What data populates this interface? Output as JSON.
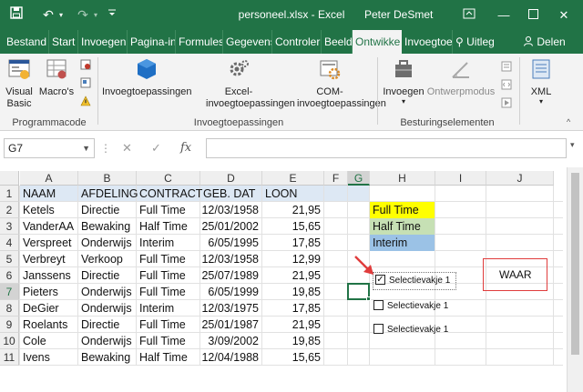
{
  "titlebar": {
    "save_icon": "save-icon",
    "undo_icon": "undo-icon",
    "redo_icon": "redo-icon",
    "title": "personeel.xlsx - Excel",
    "user": "Peter DeSmet",
    "accent": "#217346"
  },
  "tabs": [
    {
      "label": "Bestand"
    },
    {
      "label": "Start"
    },
    {
      "label": "Invoegen"
    },
    {
      "label": "Pagina-in"
    },
    {
      "label": "Formules"
    },
    {
      "label": "Gegevens"
    },
    {
      "label": "Controler"
    },
    {
      "label": "Beeld"
    },
    {
      "label": "Ontwikke"
    },
    {
      "label": "Invoegtoe"
    },
    {
      "label": "Uitleg"
    }
  ],
  "share_label": "Delen",
  "ribbon": {
    "vb_label": "Visual Basic",
    "macros_label": "Macro's",
    "group1": "Programmacode",
    "invoeg_label": "Invoegtoepassingen",
    "excel_invoeg_label": "Excel-invoegtoepassingen",
    "com_invoeg_label": "COM-invoegtoepassingen",
    "group2": "Invoegtoepassingen",
    "invoegen_label": "Invoegen",
    "ontwerpmodus_label": "Ontwerpmodus",
    "group3": "Besturingselementen",
    "xml_label": "XML"
  },
  "formula_bar": {
    "namebox": "G7",
    "fx": "fx",
    "content": ""
  },
  "grid": {
    "columns": [
      "A",
      "B",
      "C",
      "D",
      "E",
      "F",
      "G",
      "H",
      "I",
      "J"
    ],
    "rows": [
      "1",
      "2",
      "3",
      "4",
      "5",
      "6",
      "7",
      "8",
      "9",
      "10",
      "11"
    ],
    "headers": [
      "NAAM",
      "AFDELING",
      "CONTRACT",
      "GEB. DAT",
      "LOON"
    ],
    "data": [
      [
        "Ketels",
        "Directie",
        "Full Time",
        "12/03/1958",
        "21,95"
      ],
      [
        "VanderAA",
        "Bewaking",
        "Half Time",
        "25/01/2002",
        "15,65"
      ],
      [
        "Verspreet",
        "Onderwijs",
        "Interim",
        "6/05/1995",
        "17,85"
      ],
      [
        "Verbreyt",
        "Verkoop",
        "Full Time",
        "12/03/1958",
        "12,99"
      ],
      [
        "Janssens",
        "Directie",
        "Full Time",
        "25/07/1989",
        "21,95"
      ],
      [
        "Pieters",
        "Onderwijs",
        "Full Time",
        "6/05/1999",
        "19,85"
      ],
      [
        "DeGier",
        "Onderwijs",
        "Interim",
        "12/03/1975",
        "17,85"
      ],
      [
        "Roelants",
        "Directie",
        "Full Time",
        "25/01/1987",
        "21,95"
      ],
      [
        "Cole",
        "Onderwijs",
        "Full Time",
        "3/09/2002",
        "19,85"
      ],
      [
        "Ivens",
        "Bewaking",
        "Half Time",
        "12/04/1988",
        "15,65"
      ]
    ],
    "legend": [
      {
        "label": "Full Time",
        "color": "#ffff00"
      },
      {
        "label": "Half Time",
        "color": "#c6e0b4"
      },
      {
        "label": "Interim",
        "color": "#9bc2e6"
      }
    ],
    "checkboxes": [
      {
        "label": "Selectievakje 1",
        "checked": true
      },
      {
        "label": "Selectievakje 1",
        "checked": false
      },
      {
        "label": "Selectievakje 1",
        "checked": false
      }
    ],
    "result_value": "WAAR",
    "annotation_color": "#e03c3c"
  }
}
